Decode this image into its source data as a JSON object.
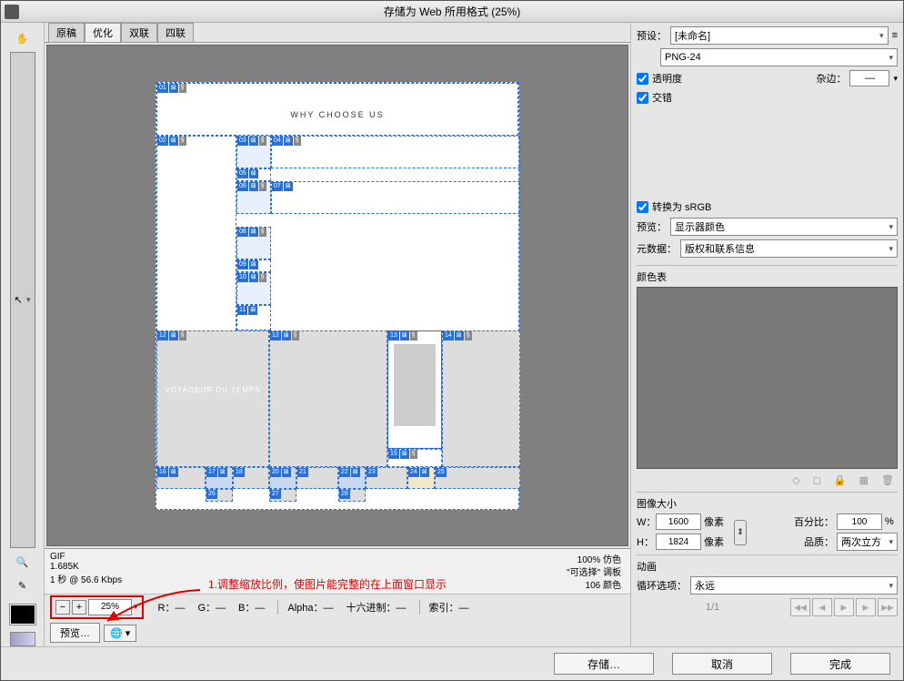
{
  "title": "存储为 Web 所用格式 (25%)",
  "tabs": [
    "原稿",
    "优化",
    "双联",
    "四联"
  ],
  "active_tab": 1,
  "canvas": {
    "heading": "WHY CHOOSE US",
    "subhead": "VOYAGEUR DU TEMPS"
  },
  "info": {
    "format": "GIF",
    "size": "1.685K",
    "time": "1 秒 @ 56.6 Kbps",
    "dither": "100% 仿色",
    "selectable": "\"可选择\" 调板",
    "colors": "106 颜色"
  },
  "annotation": "1.调整缩放比例，使图片能完整的在上面窗口显示",
  "zoom": {
    "value": "25%",
    "channels": {
      "R": "—",
      "G": "—",
      "B": "—",
      "Alpha": "—",
      "hex_label": "十六进制：",
      "hex": "—",
      "idx_label": "索引：",
      "idx": "—"
    }
  },
  "preview_btn": "预览…",
  "right": {
    "preset_label": "预设：",
    "preset_value": "[未命名]",
    "format": "PNG-24",
    "transparency": "透明度",
    "interlace": "交错",
    "matte_label": "杂边：",
    "convert_srgb": "转换为 sRGB",
    "preview_label": "预览：",
    "preview_value": "显示器颜色",
    "metadata_label": "元数据：",
    "metadata_value": "版权和联系信息",
    "color_table": "颜色表",
    "image_size": "图像大小",
    "width_label": "W：",
    "width": "1600",
    "px1": "像素",
    "height_label": "H：",
    "height": "1824",
    "px2": "像素",
    "percent_label": "百分比：",
    "percent": "100",
    "pct": "%",
    "quality_label": "品质：",
    "quality": "两次立方",
    "anim": "动画",
    "loop_label": "循环选项：",
    "loop_value": "永远",
    "page": "1/1"
  },
  "buttons": {
    "save": "存储…",
    "cancel": "取消",
    "done": "完成"
  },
  "slices": [
    "01",
    "02",
    "03",
    "04",
    "05",
    "06",
    "07",
    "08",
    "09",
    "10",
    "11",
    "12",
    "13",
    "14",
    "15",
    "16",
    "17",
    "18",
    "19",
    "20",
    "21",
    "22",
    "23",
    "24",
    "25",
    "26",
    "27",
    "28"
  ]
}
